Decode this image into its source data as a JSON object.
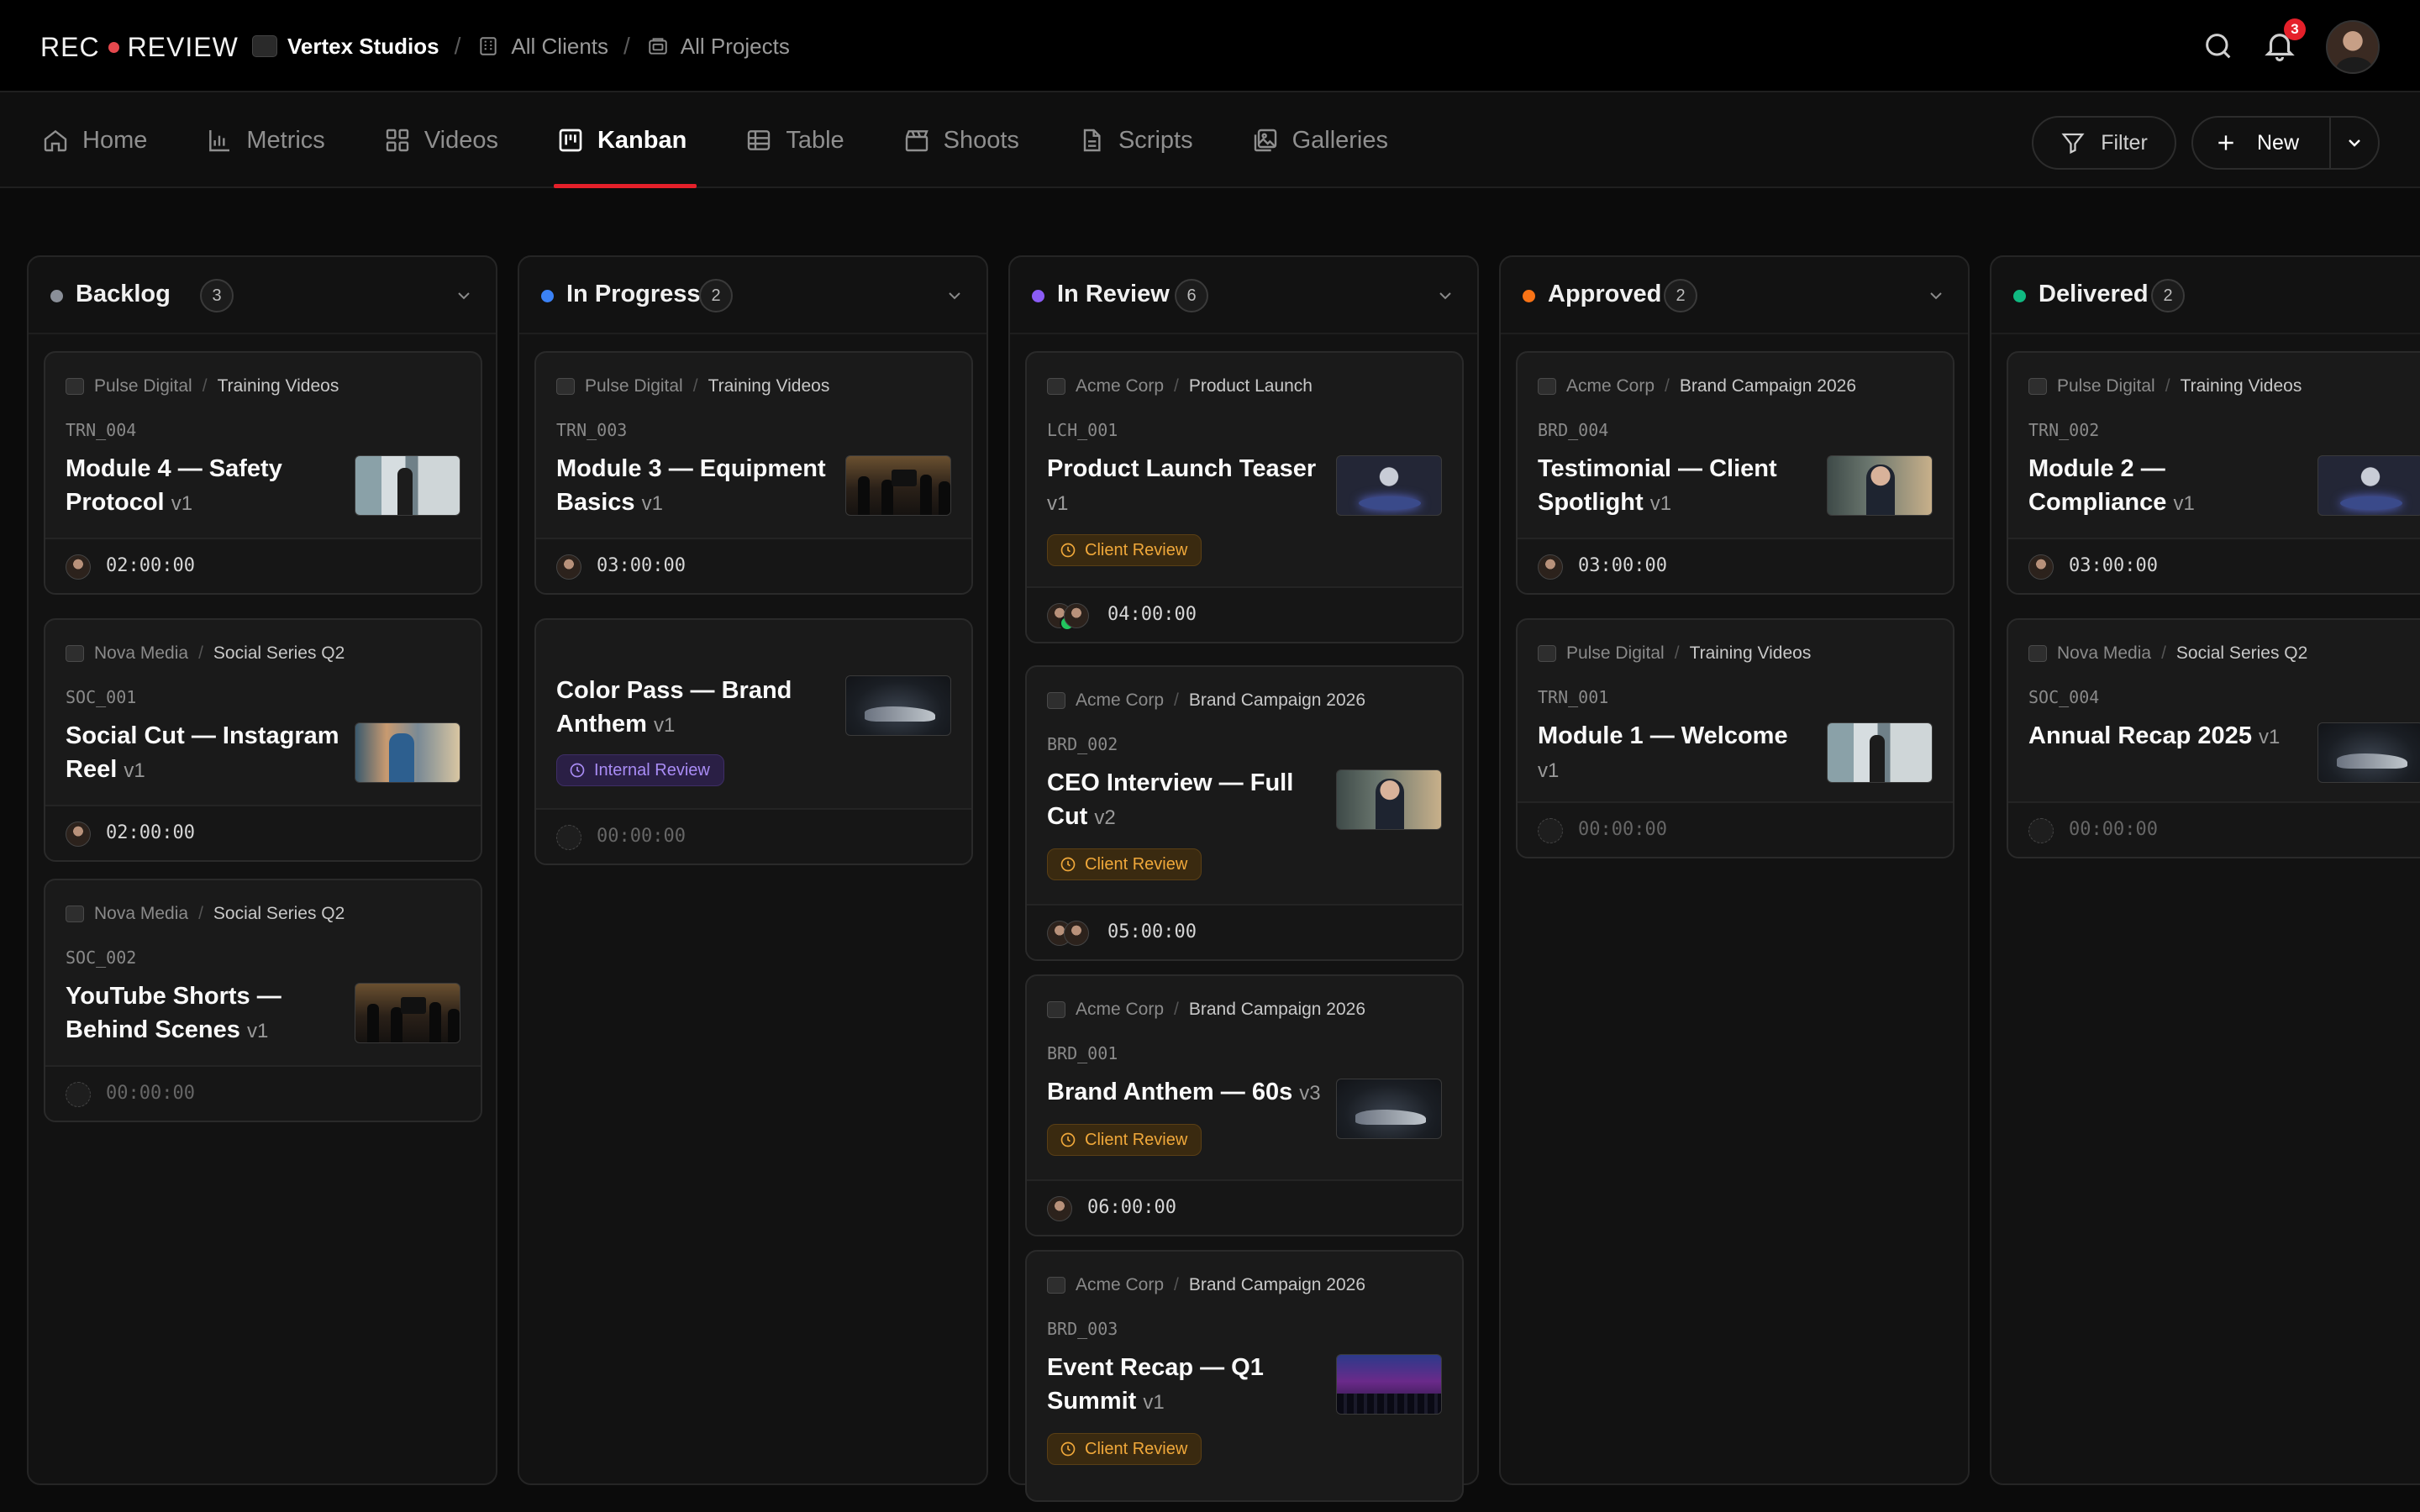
{
  "brand": {
    "left": "REC",
    "right": "REVIEW",
    "dot_color": "#e5484d"
  },
  "breadcrumb": [
    {
      "label": "Vertex Studios",
      "icon": "studio-logo-icon"
    },
    {
      "label": "All Clients",
      "icon": "building-icon"
    },
    {
      "label": "All Projects",
      "icon": "folder-icon"
    }
  ],
  "notifications": {
    "count": "3"
  },
  "tabs": [
    {
      "label": "Home",
      "icon": "home-icon"
    },
    {
      "label": "Metrics",
      "icon": "bar-chart-icon"
    },
    {
      "label": "Videos",
      "icon": "grid-icon"
    },
    {
      "label": "Kanban",
      "icon": "kanban-icon",
      "active": true
    },
    {
      "label": "Table",
      "icon": "table-icon"
    },
    {
      "label": "Shoots",
      "icon": "clapper-icon"
    },
    {
      "label": "Scripts",
      "icon": "document-icon"
    },
    {
      "label": "Galleries",
      "icon": "gallery-icon"
    }
  ],
  "toolbar": {
    "filter_label": "Filter",
    "new_label": "New"
  },
  "columns": [
    {
      "title": "Backlog",
      "count": "3",
      "color": "#8a8f98",
      "cards": [
        {
          "client": "Pulse Digital",
          "project": "Training Videos",
          "code": "TRN_004",
          "title": "Module 4 — Safety Protocol",
          "version": "v1",
          "duration": "02:00:00",
          "thumb": "office"
        },
        {
          "client": "Nova Media",
          "project": "Social Series Q2",
          "code": "SOC_001",
          "title": "Social Cut — Instagram Reel",
          "version": "v1",
          "duration": "02:00:00",
          "thumb": "street"
        },
        {
          "client": "Nova Media",
          "project": "Social Series Q2",
          "code": "SOC_002",
          "title": "YouTube Shorts — Behind Scenes",
          "version": "v1",
          "duration": "00:00:00",
          "thumb": "crew"
        }
      ]
    },
    {
      "title": "In Progress",
      "count": "2",
      "color": "#3b82f6",
      "cards": [
        {
          "client": "Pulse Digital",
          "project": "Training Videos",
          "code": "TRN_003",
          "title": "Module 3 — Equipment Basics",
          "version": "v1",
          "duration": "03:00:00",
          "thumb": "crew"
        },
        {
          "client": "",
          "project": "",
          "code": "",
          "title": "Color Pass — Brand Anthem",
          "version": "v1",
          "badge": "Internal Review",
          "duration": "00:00:00",
          "thumb": "shoe"
        }
      ]
    },
    {
      "title": "In Review",
      "count": "6",
      "color": "#8b5cf6",
      "cards": [
        {
          "client": "Acme Corp",
          "project": "Product Launch",
          "code": "LCH_001",
          "title": "Product Launch Teaser",
          "version": "v1",
          "badge": "Client Review",
          "duration": "04:00:00",
          "thumb": "product"
        },
        {
          "client": "Acme Corp",
          "project": "Brand Campaign 2026",
          "code": "BRD_002",
          "title": "CEO Interview — Full Cut",
          "version": "v2",
          "badge": "Client Review",
          "duration": "05:00:00",
          "thumb": "exec"
        },
        {
          "client": "Acme Corp",
          "project": "Brand Campaign 2026",
          "code": "BRD_001",
          "title": "Brand Anthem — 60s",
          "version": "v3",
          "badge": "Client Review",
          "duration": "06:00:00",
          "thumb": "shoe"
        },
        {
          "client": "Acme Corp",
          "project": "Brand Campaign 2026",
          "code": "BRD_003",
          "title": "Event Recap — Q1 Summit",
          "version": "v1",
          "badge": "Client Review",
          "duration": "",
          "thumb": "event"
        }
      ]
    },
    {
      "title": "Approved",
      "count": "2",
      "color": "#f97316",
      "cards": [
        {
          "client": "Acme Corp",
          "project": "Brand Campaign 2026",
          "code": "BRD_004",
          "title": "Testimonial — Client Spotlight",
          "version": "v1",
          "duration": "03:00:00",
          "thumb": "exec"
        },
        {
          "client": "Pulse Digital",
          "project": "Training Videos",
          "code": "TRN_001",
          "title": "Module 1 — Welcome",
          "version": "v1",
          "duration": "00:00:00",
          "thumb": "office"
        }
      ]
    },
    {
      "title": "Delivered",
      "count": "2",
      "color": "#10b981",
      "cards": [
        {
          "client": "Pulse Digital",
          "project": "Training Videos",
          "code": "TRN_002",
          "title": "Module 2 — Compliance",
          "version": "v1",
          "duration": "03:00:00",
          "thumb": "product"
        },
        {
          "client": "Nova Media",
          "project": "Social Series Q2",
          "code": "SOC_004",
          "title": "Annual Recap 2025",
          "version": "v1",
          "duration": "00:00:00",
          "thumb": "shoe"
        }
      ]
    }
  ]
}
